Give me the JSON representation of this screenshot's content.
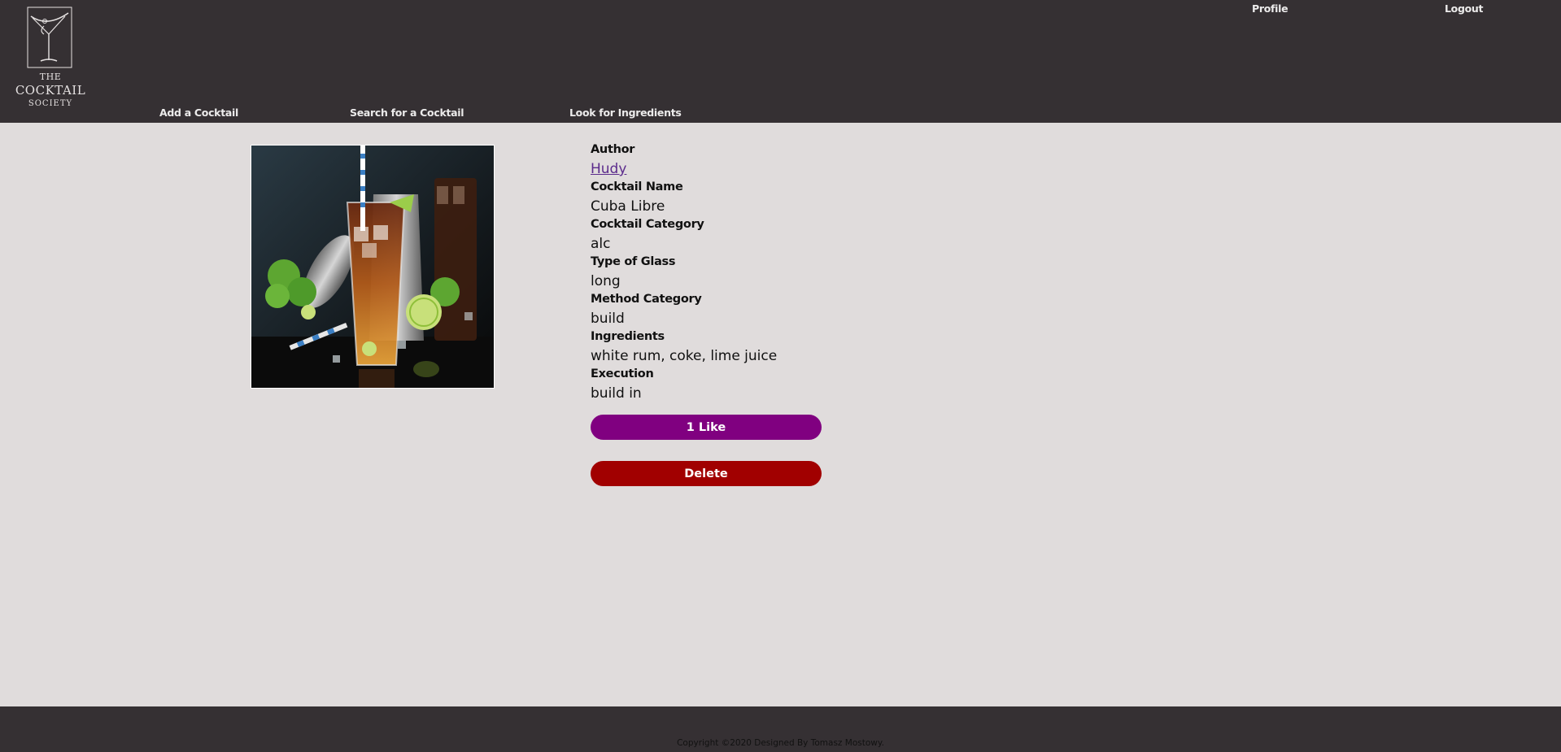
{
  "brand": {
    "line1": "THE",
    "line2": "COCKTAIL",
    "line3": "SOCIETY"
  },
  "header": {
    "profile_label": "Profile",
    "logout_label": "Logout"
  },
  "nav": {
    "add_label": "Add a Cocktail",
    "search_label": "Search for a Cocktail",
    "ingredients_label": "Look for Ingredients"
  },
  "cocktail": {
    "image_alt": "Cuba Libre photo",
    "author_label": "Author",
    "author_value": "Hudy",
    "name_label": "Cocktail Name",
    "name_value": "Cuba Libre",
    "category_label": "Cocktail Category",
    "category_value": "alc",
    "glass_label": "Type of Glass",
    "glass_value": "long",
    "method_label": "Method Category",
    "method_value": "build",
    "ingredients_label": "Ingredients",
    "ingredients_value": "white rum, coke, lime juice",
    "execution_label": "Execution",
    "execution_value": "build in"
  },
  "actions": {
    "like_label": "1 Like",
    "delete_label": "Delete"
  },
  "footer": {
    "copyright": "Copyright ©2020 Designed By Tomasz Mostowy."
  },
  "colors": {
    "header_bg": "#353033",
    "page_bg": "#e0dcdc",
    "like_btn": "#800080",
    "delete_btn": "#a10000",
    "link": "#5b2b8c"
  },
  "icons": {
    "logo": "martini-glass-logo"
  }
}
